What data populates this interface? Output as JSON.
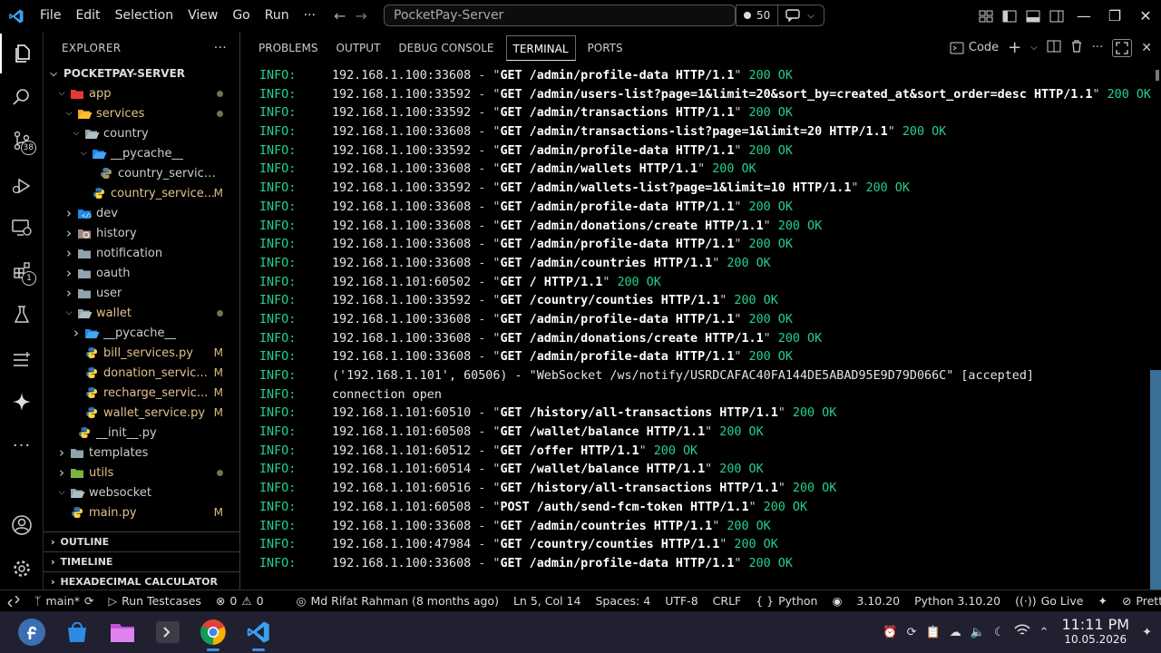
{
  "menu": [
    "File",
    "Edit",
    "Selection",
    "View",
    "Go",
    "Run",
    "···"
  ],
  "command_center": "PocketPay-Server",
  "copilot_count": "50",
  "activity_badges": {
    "source_control": "38",
    "extensions": "1"
  },
  "explorer": {
    "title": "EXPLORER",
    "more": "···",
    "root": "POCKETPAY-SERVER",
    "items": [
      {
        "label": "app",
        "depth": 1,
        "type": "folder-open",
        "color": "yellow"
      },
      {
        "label": "services",
        "depth": 2,
        "type": "folder-open",
        "color": "yellow"
      },
      {
        "label": "country",
        "depth": 3,
        "type": "folder-open",
        "color": "white"
      },
      {
        "label": "__pycache__",
        "depth": 4,
        "type": "folder-open",
        "color": "white"
      },
      {
        "label": "country_service.cpy...",
        "depth": 5,
        "type": "file",
        "color": "white"
      },
      {
        "label": "country_service...",
        "depth": 4,
        "type": "py",
        "color": "yellow",
        "mod": "M"
      },
      {
        "label": "dev",
        "depth": 2,
        "type": "folder",
        "color": "white"
      },
      {
        "label": "history",
        "depth": 2,
        "type": "folder",
        "color": "white"
      },
      {
        "label": "notification",
        "depth": 2,
        "type": "folder",
        "color": "white"
      },
      {
        "label": "oauth",
        "depth": 2,
        "type": "folder",
        "color": "white"
      },
      {
        "label": "user",
        "depth": 2,
        "type": "folder",
        "color": "white"
      },
      {
        "label": "wallet",
        "depth": 2,
        "type": "folder-open",
        "color": "yellow"
      },
      {
        "label": "__pycache__",
        "depth": 3,
        "type": "folder",
        "color": "white"
      },
      {
        "label": "bill_services.py",
        "depth": 3,
        "type": "py",
        "color": "yellow",
        "mod": "M"
      },
      {
        "label": "donation_servic...",
        "depth": 3,
        "type": "py",
        "color": "yellow",
        "mod": "M"
      },
      {
        "label": "recharge_servic...",
        "depth": 3,
        "type": "py",
        "color": "yellow",
        "mod": "M"
      },
      {
        "label": "wallet_service.py",
        "depth": 3,
        "type": "py",
        "color": "yellow",
        "mod": "M"
      },
      {
        "label": "__init__.py",
        "depth": 2,
        "type": "py",
        "color": "white"
      },
      {
        "label": "templates",
        "depth": 1,
        "type": "folder",
        "color": "white"
      },
      {
        "label": "utils",
        "depth": 1,
        "type": "folder",
        "color": "yellow"
      },
      {
        "label": "websocket",
        "depth": 1,
        "type": "folder-open",
        "color": "white"
      },
      {
        "label": "main.py",
        "depth": 1,
        "type": "py",
        "color": "yellow",
        "mod": "M"
      }
    ],
    "sections": [
      "OUTLINE",
      "TIMELINE",
      "HEXADECIMAL CALCULATOR"
    ]
  },
  "panel": {
    "tabs": [
      "PROBLEMS",
      "OUTPUT",
      "DEBUG CONSOLE",
      "TERMINAL",
      "PORTS"
    ],
    "active_tab": "TERMINAL",
    "terminal_name": "Code"
  },
  "terminal_lines": [
    {
      "level": "INFO:",
      "addr": "192.168.1.100:33608",
      "req": "GET /admin/profile-data HTTP/1.1",
      "status": "200 OK"
    },
    {
      "level": "INFO:",
      "addr": "192.168.1.100:33592",
      "req": "GET /admin/users-list?page=1&limit=20&sort_by=created_at&sort_order=desc HTTP/1.1",
      "status": "200 OK"
    },
    {
      "level": "INFO:",
      "addr": "192.168.1.100:33592",
      "req": "GET /admin/transactions HTTP/1.1",
      "status": "200 OK"
    },
    {
      "level": "INFO:",
      "addr": "192.168.1.100:33608",
      "req": "GET /admin/transactions-list?page=1&limit=20 HTTP/1.1",
      "status": "200 OK"
    },
    {
      "level": "INFO:",
      "addr": "192.168.1.100:33592",
      "req": "GET /admin/profile-data HTTP/1.1",
      "status": "200 OK"
    },
    {
      "level": "INFO:",
      "addr": "192.168.1.100:33608",
      "req": "GET /admin/wallets HTTP/1.1",
      "status": "200 OK"
    },
    {
      "level": "INFO:",
      "addr": "192.168.1.100:33592",
      "req": "GET /admin/wallets-list?page=1&limit=10 HTTP/1.1",
      "status": "200 OK"
    },
    {
      "level": "INFO:",
      "addr": "192.168.1.100:33608",
      "req": "GET /admin/profile-data HTTP/1.1",
      "status": "200 OK"
    },
    {
      "level": "INFO:",
      "addr": "192.168.1.100:33608",
      "req": "GET /admin/donations/create HTTP/1.1",
      "status": "200 OK"
    },
    {
      "level": "INFO:",
      "addr": "192.168.1.100:33608",
      "req": "GET /admin/profile-data HTTP/1.1",
      "status": "200 OK"
    },
    {
      "level": "INFO:",
      "addr": "192.168.1.100:33608",
      "req": "GET /admin/countries HTTP/1.1",
      "status": "200 OK"
    },
    {
      "level": "INFO:",
      "addr": "192.168.1.101:60502",
      "req": "GET / HTTP/1.1",
      "status": "200 OK"
    },
    {
      "level": "INFO:",
      "addr": "192.168.1.100:33592",
      "req": "GET /country/counties HTTP/1.1",
      "status": "200 OK"
    },
    {
      "level": "INFO:",
      "addr": "192.168.1.100:33608",
      "req": "GET /admin/profile-data HTTP/1.1",
      "status": "200 OK"
    },
    {
      "level": "INFO:",
      "addr": "192.168.1.100:33608",
      "req": "GET /admin/donations/create HTTP/1.1",
      "status": "200 OK"
    },
    {
      "level": "INFO:",
      "addr": "192.168.1.100:33608",
      "req": "GET /admin/profile-data HTTP/1.1",
      "status": "200 OK"
    },
    {
      "level": "INFO:",
      "text": "('192.168.1.101', 60506) - \"WebSocket /ws/notify/USRDCAFAC40FA144DE5ABAD95E9D79D066C\" [accepted]"
    },
    {
      "level": "INFO:",
      "text": "connection open"
    },
    {
      "level": "INFO:",
      "addr": "192.168.1.101:60510",
      "req": "GET /history/all-transactions HTTP/1.1",
      "status": "200 OK"
    },
    {
      "level": "INFO:",
      "addr": "192.168.1.101:60508",
      "req": "GET /wallet/balance HTTP/1.1",
      "status": "200 OK"
    },
    {
      "level": "INFO:",
      "addr": "192.168.1.101:60512",
      "req": "GET /offer HTTP/1.1",
      "status": "200 OK"
    },
    {
      "level": "INFO:",
      "addr": "192.168.1.101:60514",
      "req": "GET /wallet/balance HTTP/1.1",
      "status": "200 OK"
    },
    {
      "level": "INFO:",
      "addr": "192.168.1.101:60516",
      "req": "GET /history/all-transactions HTTP/1.1",
      "status": "200 OK"
    },
    {
      "level": "INFO:",
      "addr": "192.168.1.101:60508",
      "req": "POST /auth/send-fcm-token HTTP/1.1",
      "status": "200 OK"
    },
    {
      "level": "INFO:",
      "addr": "192.168.1.100:33608",
      "req": "GET /admin/countries HTTP/1.1",
      "status": "200 OK"
    },
    {
      "level": "INFO:",
      "addr": "192.168.1.100:47984",
      "req": "GET /country/counties HTTP/1.1",
      "status": "200 OK"
    },
    {
      "level": "INFO:",
      "addr": "192.168.1.100:33608",
      "req": "GET /admin/profile-data HTTP/1.1",
      "status": "200 OK"
    }
  ],
  "statusbar": {
    "branch": "main*",
    "run_testcases": "Run Testcases",
    "errors": "0",
    "warnings": "0",
    "blame": "Md Rifat Rahman (8 months ago)",
    "position": "Ln 5, Col 14",
    "spaces": "Spaces: 4",
    "encoding": "UTF-8",
    "eol": "CRLF",
    "language": "Python",
    "braces": "{ }",
    "version": "3.10.20",
    "interpreter": "Python 3.10.20",
    "go_live": "Go Live",
    "prettier": "Prettier"
  },
  "taskbar": {
    "time": "11:11 PM",
    "date": "10.05.2026"
  },
  "colors": {
    "accent": "#3c8fe8",
    "info_green": "#23d18b",
    "modified": "#e2c08d"
  }
}
